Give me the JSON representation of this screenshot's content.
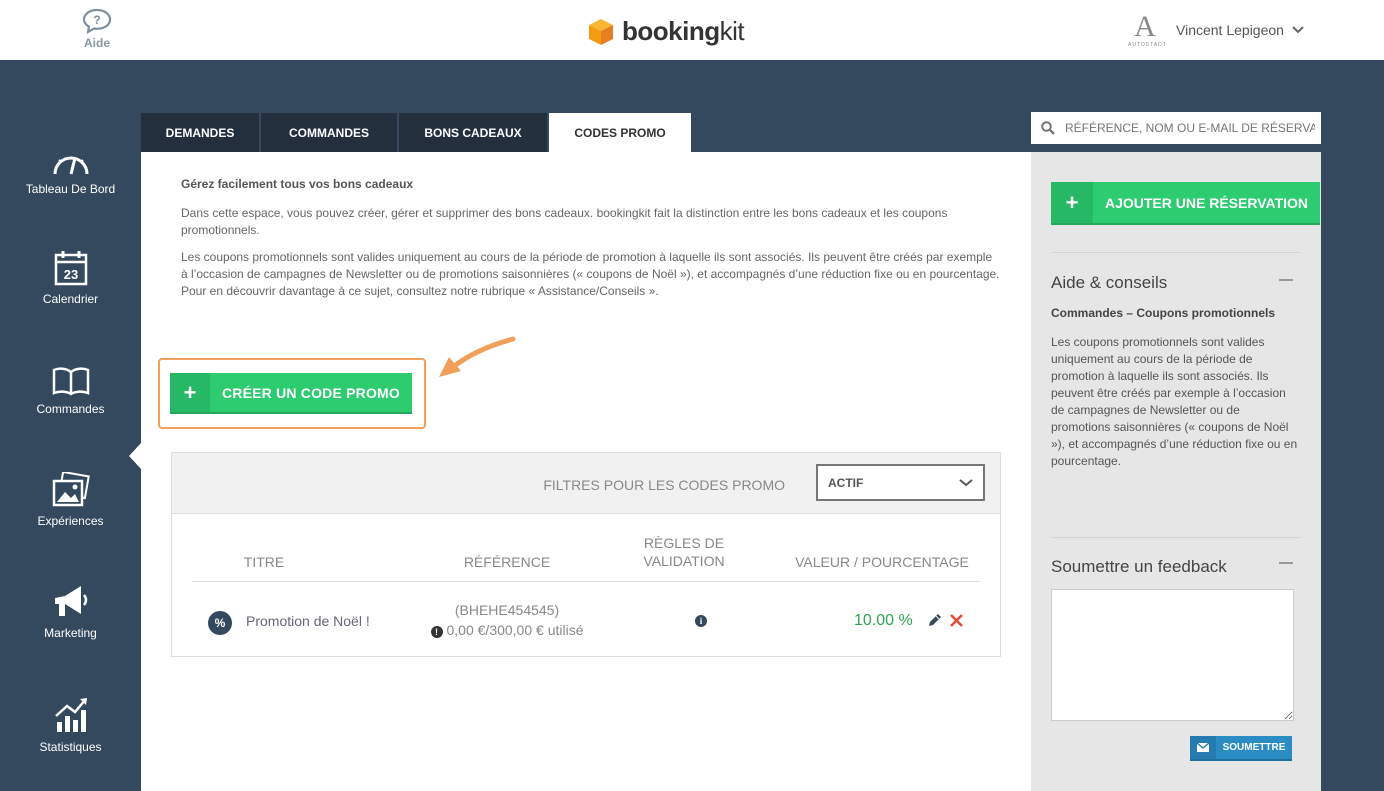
{
  "header": {
    "help_label": "Aide",
    "brand_bold": "booking",
    "brand_light": "kit",
    "user_logo": "A",
    "user_logo_caption": "AUTOSTADT",
    "user_name": "Vincent Lepigeon"
  },
  "sidebar": {
    "items": [
      {
        "label": "Tableau De Bord",
        "icon": "speedometer-icon"
      },
      {
        "label": "Calendrier",
        "icon": "calendar-icon",
        "day": "23"
      },
      {
        "label": "Commandes",
        "icon": "book-icon",
        "active": true
      },
      {
        "label": "Expériences",
        "icon": "photos-icon"
      },
      {
        "label": "Marketing",
        "icon": "megaphone-icon"
      },
      {
        "label": "Statistiques",
        "icon": "chart-icon"
      }
    ]
  },
  "tabs": [
    {
      "label": "DEMANDES"
    },
    {
      "label": "COMMANDES"
    },
    {
      "label": "BONS CADEAUX"
    },
    {
      "label": "CODES PROMO",
      "active": true
    }
  ],
  "intro": {
    "title": "Gérez facilement tous vos bons cadeaux",
    "p1": "Dans cette espace, vous pouvez créer, gérer et supprimer des bons cadeaux. bookingkit fait la distinction entre les bons cadeaux et les coupons promotionnels.",
    "p2": "Les coupons promotionnels sont valides uniquement au cours de la période de promotion à laquelle ils sont associés. Ils peuvent être créés par exemple à l’occasion de campagnes de Newsletter ou de promotions saisonnières (« coupons de Noël »), et accompagnés d’une réduction fixe ou en pourcentage. Pour en découvrir davantage à ce sujet, consultez notre rubrique « Assistance/Conseils »."
  },
  "create_button": {
    "plus": "+",
    "label": "CRÉER UN CODE PROMO"
  },
  "filter": {
    "label": "FILTRES POUR LES CODES PROMO",
    "selected": "ACTIF"
  },
  "table": {
    "headers": {
      "title": "TITRE",
      "reference": "RÉFÉRENCE",
      "rules_line1": "RÈGLES DE",
      "rules_line2": "VALIDATION",
      "value": "VALEUR / POURCENTAGE"
    },
    "rows": [
      {
        "icon": "%",
        "title": "Promotion de Noël !",
        "reference": "(BHEHE454545)",
        "usage": "0,00 €/300,00 € utilisé",
        "value": "10.00 %"
      }
    ]
  },
  "right": {
    "search_placeholder": "RÉFÉRENCE, NOM OU E-MAIL DE RÉSERVATION",
    "add_button": {
      "plus": "+",
      "label": "AJOUTER UNE RÉSERVATION"
    },
    "help_title": "Aide & conseils",
    "help_subtitle": "Commandes – Coupons promotionnels",
    "help_text": "Les coupons promotionnels sont valides uniquement au cours de la période de promotion à laquelle ils sont associés. Ils peuvent être créés par exemple à l’occasion de campagnes de Newsletter ou de promotions saisonnières (« coupons de Noël »), et accompagnés d’une réduction fixe ou en pourcentage.",
    "feedback_title": "Soumettre un feedback",
    "submit_label": "SOUMETTRE"
  },
  "colors": {
    "sidebar_bg": "#34495e",
    "tab_dark": "#232f3d",
    "green": "#2ecc71",
    "highlight_orange": "#f0a05a",
    "blue_button": "#2b8cc4"
  }
}
